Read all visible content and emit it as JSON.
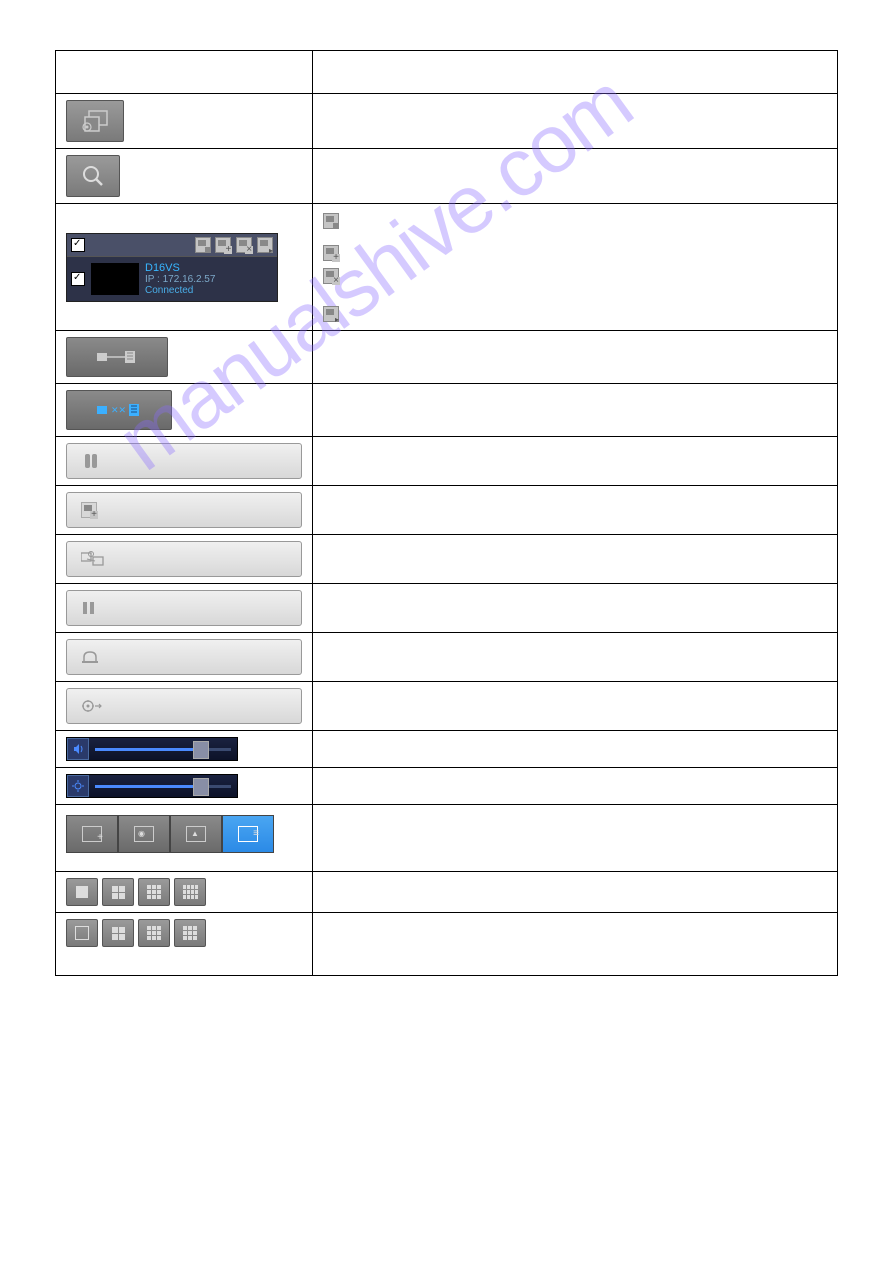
{
  "table": {
    "header": {
      "left": "",
      "right": ""
    },
    "rows": [
      {
        "icon": "webpage-setup-icon",
        "desc": ""
      },
      {
        "icon": "search-icon",
        "desc": ""
      },
      {
        "device": {
          "name": "D16VS",
          "ip": "IP : 172.16.2.57",
          "status": "Connected"
        },
        "desc": ""
      },
      {
        "icon": "connect-icon",
        "desc": ""
      },
      {
        "icon": "disconnect-icon",
        "desc": ""
      },
      {
        "icon": "health-icon",
        "desc": ""
      },
      {
        "icon": "add-icon",
        "desc": ""
      },
      {
        "icon": "group-icon",
        "desc": ""
      },
      {
        "icon": "pause-icon",
        "desc": ""
      },
      {
        "icon": "alarm-icon",
        "desc": ""
      },
      {
        "icon": "preference-icon",
        "desc": ""
      },
      {
        "icon": "audio-slider",
        "desc": ""
      },
      {
        "icon": "ptz-slider",
        "desc": ""
      },
      {
        "icon": "panel-tabs",
        "desc": ""
      },
      {
        "icon": "split-grid",
        "desc": ""
      },
      {
        "icon": "split-grid-alt",
        "desc": ""
      }
    ]
  },
  "watermark": "manualshive.com"
}
